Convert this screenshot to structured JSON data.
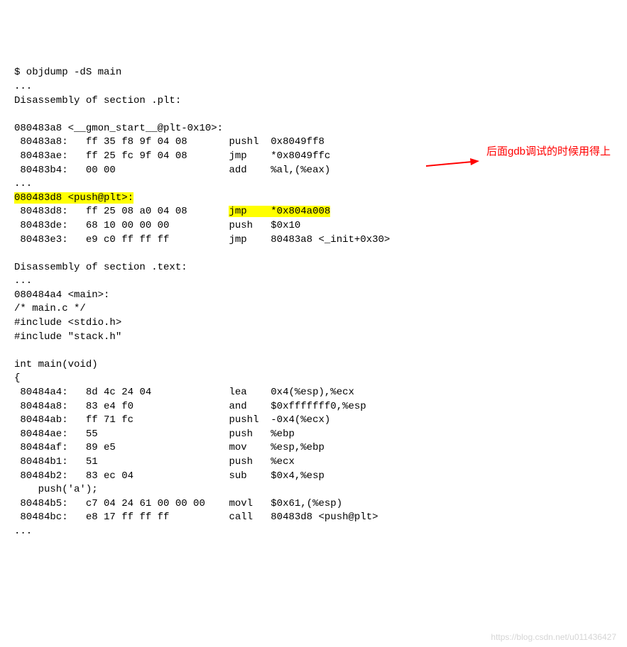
{
  "command": "$ objdump -dS main",
  "ellipsis": "...",
  "plt_header": "Disassembly of section .plt:",
  "sym1": "080483a8 <__gmon_start__@plt-0x10>:",
  "l1_addr": " 80483a8:",
  "l1_hex": "   ff 35 f8 9f 04 08   ",
  "l1_op": "    pushl  0x8049ff8",
  "l2_addr": " 80483ae:",
  "l2_hex": "   ff 25 fc 9f 04 08   ",
  "l2_op": "    jmp    *0x8049ffc",
  "l3_addr": " 80483b4:",
  "l3_hex": "   00 00               ",
  "l3_op": "    add    %al,(%eax)",
  "sym2": "080483d8 <push@plt>:",
  "l4_addr": " 80483d8:",
  "l4_hex": "   ff 25 08 a0 04 08   ",
  "l4_sp": "    ",
  "l4_op": "jmp    *0x804a008",
  "l5_addr": " 80483de:",
  "l5_hex": "   68 10 00 00 00      ",
  "l5_op": "    push   $0x10",
  "l6_addr": " 80483e3:",
  "l6_hex": "   e9 c0 ff ff ff      ",
  "l6_op": "    jmp    80483a8 <_init+0x30>",
  "text_header": "Disassembly of section .text:",
  "sym3": "080484a4 <main>:",
  "comment": "/* main.c */",
  "inc1": "#include <stdio.h>",
  "inc2": "#include \"stack.h\"",
  "func_sig": "int main(void)",
  "brace": "{",
  "m1_addr": " 80484a4:",
  "m1_hex": "   8d 4c 24 04         ",
  "m1_op": "    lea    0x4(%esp),%ecx",
  "m2_addr": " 80484a8:",
  "m2_hex": "   83 e4 f0            ",
  "m2_op": "    and    $0xfffffff0,%esp",
  "m3_addr": " 80484ab:",
  "m3_hex": "   ff 71 fc            ",
  "m3_op": "    pushl  -0x4(%ecx)",
  "m4_addr": " 80484ae:",
  "m4_hex": "   55                  ",
  "m4_op": "    push   %ebp",
  "m5_addr": " 80484af:",
  "m5_hex": "   89 e5               ",
  "m5_op": "    mov    %esp,%ebp",
  "m6_addr": " 80484b1:",
  "m6_hex": "   51                  ",
  "m6_op": "    push   %ecx",
  "m7_addr": " 80484b2:",
  "m7_hex": "   83 ec 04            ",
  "m7_op": "    sub    $0x4,%esp",
  "src1": "    push('a');",
  "m8_addr": " 80484b5:",
  "m8_hex": "   c7 04 24 61 00 00 00",
  "m8_op": "    movl   $0x61,(%esp)",
  "m9_addr": " 80484bc:",
  "m9_hex": "   e8 17 ff ff ff      ",
  "m9_op": "    call   80483d8 <push@plt>",
  "annotation_text": "后面gdb调试的时候用得上",
  "watermark": "https://blog.csdn.net/u011436427"
}
